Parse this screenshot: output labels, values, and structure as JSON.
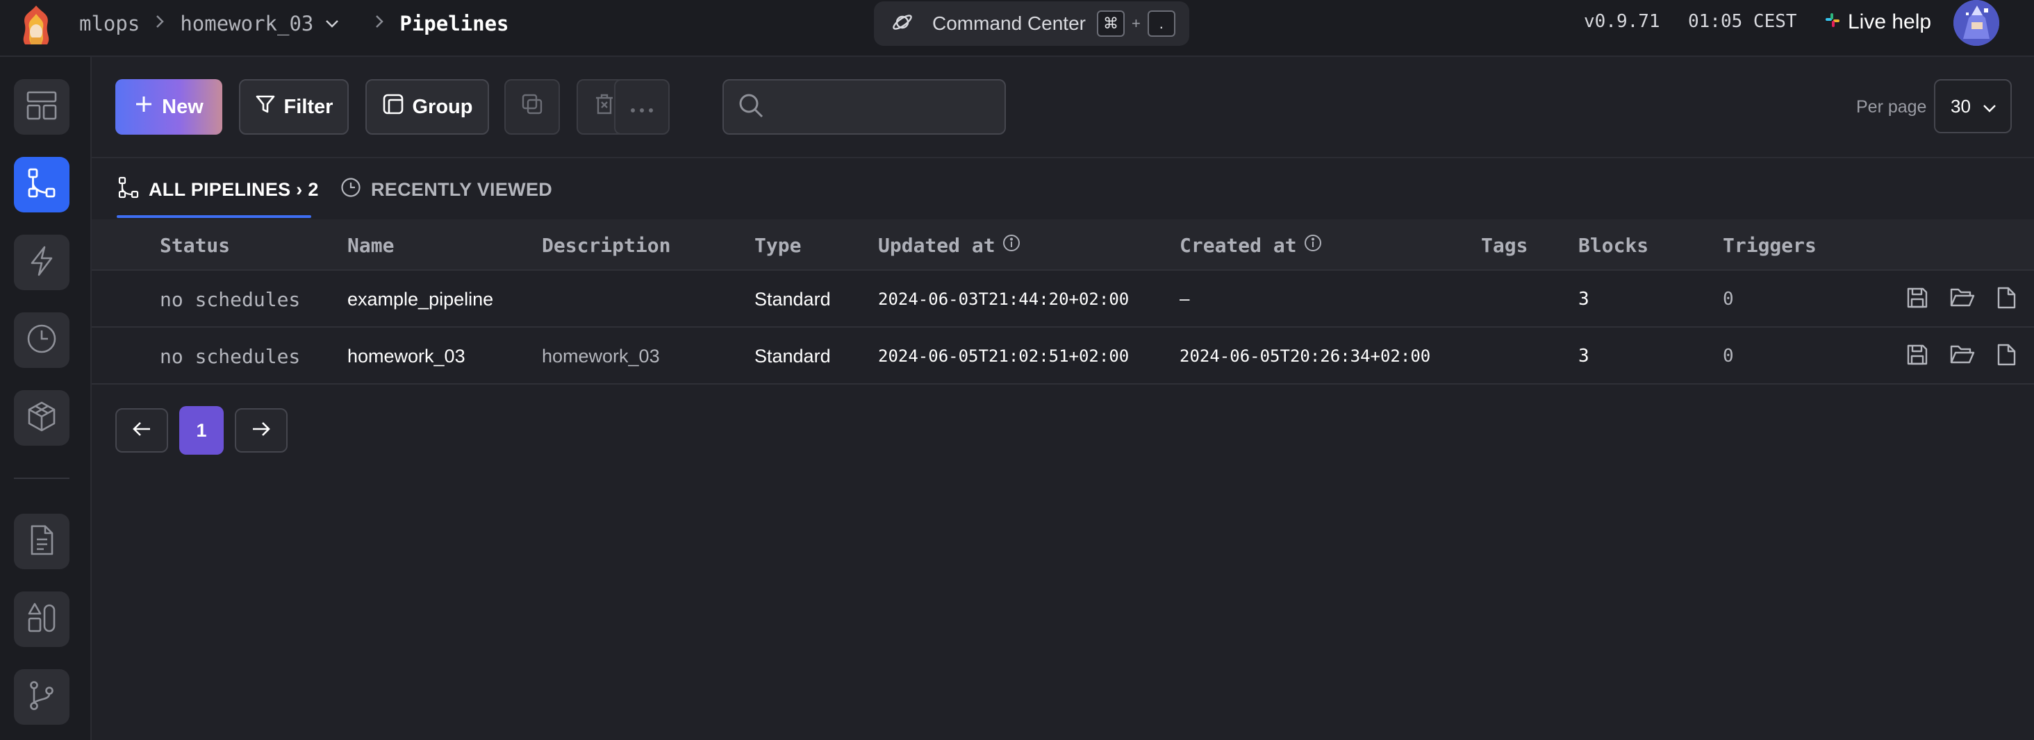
{
  "header": {
    "breadcrumb": {
      "root": "mlops",
      "project": "homework_03",
      "current": "Pipelines"
    },
    "command_center": {
      "label": "Command Center",
      "key1": "⌘",
      "plus": "+",
      "key2": "."
    },
    "version": "v0.9.71",
    "time": "01:05 CEST",
    "live_help": "Live help"
  },
  "sidebar": {
    "items": [
      {
        "name": "overview",
        "icon": "layout-icon",
        "active": false
      },
      {
        "name": "pipelines",
        "icon": "pipelines-icon",
        "active": true
      },
      {
        "name": "triggers",
        "icon": "lightning-icon",
        "active": false
      },
      {
        "name": "runs",
        "icon": "clock-icon",
        "active": false
      },
      {
        "name": "block-library",
        "icon": "cube-icon",
        "active": false
      },
      {
        "name": "files",
        "icon": "file-icon",
        "active": false
      },
      {
        "name": "templates",
        "icon": "shapes-icon",
        "active": false
      },
      {
        "name": "version-control",
        "icon": "branch-icon",
        "active": false
      }
    ]
  },
  "toolbar": {
    "new_label": "New",
    "filter_label": "Filter",
    "group_label": "Group",
    "search_placeholder": "",
    "per_page_label": "Per page",
    "per_page_value": "30"
  },
  "tabs": {
    "all_label": "ALL PIPELINES › 2",
    "recent_label": "RECENTLY VIEWED"
  },
  "table": {
    "headers": {
      "status": "Status",
      "name": "Name",
      "description": "Description",
      "type": "Type",
      "updated": "Updated at",
      "created": "Created at",
      "tags": "Tags",
      "blocks": "Blocks",
      "triggers": "Triggers"
    },
    "rows": [
      {
        "status": "no schedules",
        "name": "example_pipeline",
        "description": "",
        "type": "Standard",
        "updated": "2024-06-03T21:44:20+02:00",
        "created": "—",
        "tags": "",
        "blocks": "3",
        "triggers": "0"
      },
      {
        "status": "no schedules",
        "name": "homework_03",
        "description": "homework_03",
        "type": "Standard",
        "updated": "2024-06-05T21:02:51+02:00",
        "created": "2024-06-05T20:26:34+02:00",
        "tags": "",
        "blocks": "3",
        "triggers": "0"
      }
    ]
  },
  "pagination": {
    "current_page": "1"
  },
  "colors": {
    "accent": "#2f66f5",
    "page_active": "#6b52d6",
    "background": "#202127"
  }
}
